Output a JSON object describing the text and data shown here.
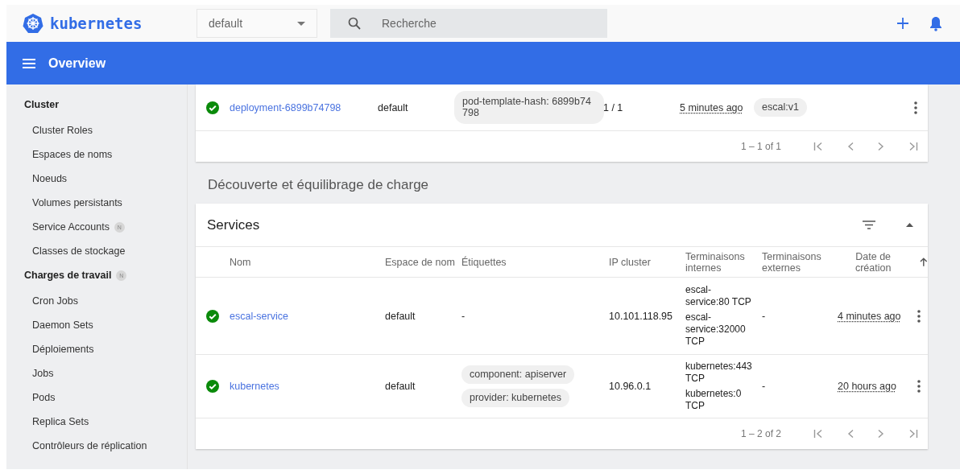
{
  "header": {
    "logo_text": "kubernetes",
    "namespace_select": {
      "value": "default"
    },
    "search": {
      "placeholder": "Recherche"
    }
  },
  "toolbar": {
    "title": "Overview"
  },
  "sidebar": {
    "sections": [
      {
        "title": "Cluster",
        "items": [
          {
            "label": "Cluster Roles"
          },
          {
            "label": "Espaces de noms"
          },
          {
            "label": "Noeuds"
          },
          {
            "label": "Volumes persistants"
          },
          {
            "label": "Service Accounts",
            "badge": "N"
          },
          {
            "label": "Classes de stockage"
          }
        ]
      },
      {
        "title": "Charges de travail",
        "badge": "N",
        "items": [
          {
            "label": "Cron Jobs"
          },
          {
            "label": "Daemon Sets"
          },
          {
            "label": "Déploiements"
          },
          {
            "label": "Jobs"
          },
          {
            "label": "Pods"
          },
          {
            "label": "Replica Sets"
          },
          {
            "label": "Contrôleurs de réplication"
          }
        ]
      }
    ]
  },
  "deployments": {
    "rows": [
      {
        "healthy": true,
        "name": "deployment-6899b74798",
        "namespace": "default",
        "labels": [
          "pod-template-hash: 6899b74798"
        ],
        "pods": "1 / 1",
        "age": "5 minutes ago",
        "images": [
          "escal:v1"
        ]
      }
    ],
    "pagination": "1 – 1 of 1"
  },
  "section_heading": "Découverte et équilibrage de charge",
  "services": {
    "title": "Services",
    "columns": [
      {
        "label": "Nom"
      },
      {
        "label": "Espace de nom"
      },
      {
        "label": "Étiquettes"
      },
      {
        "label": "IP cluster"
      },
      {
        "label": "Terminaisons internes"
      },
      {
        "label": "Terminaisons externes"
      },
      {
        "label": "Date de création",
        "sorted_ascending": true
      }
    ],
    "rows": [
      {
        "healthy": true,
        "name": "escal-service",
        "namespace": "default",
        "labels": [],
        "labels_text": "-",
        "cluster_ip": "10.101.118.95",
        "internal_endpoints": [
          "escal-service:80 TCP",
          "escal-service:32000 TCP"
        ],
        "external_endpoints": "-",
        "age": "4 minutes ago"
      },
      {
        "healthy": true,
        "name": "kubernetes",
        "namespace": "default",
        "labels": [
          "component: apiserver",
          "provider: kubernetes"
        ],
        "cluster_ip": "10.96.0.1",
        "internal_endpoints": [
          "kubernetes:443 TCP",
          "kubernetes:0 TCP"
        ],
        "external_endpoints": "-",
        "age": "20 hours ago"
      }
    ],
    "pagination": "1 – 2 of 2"
  }
}
